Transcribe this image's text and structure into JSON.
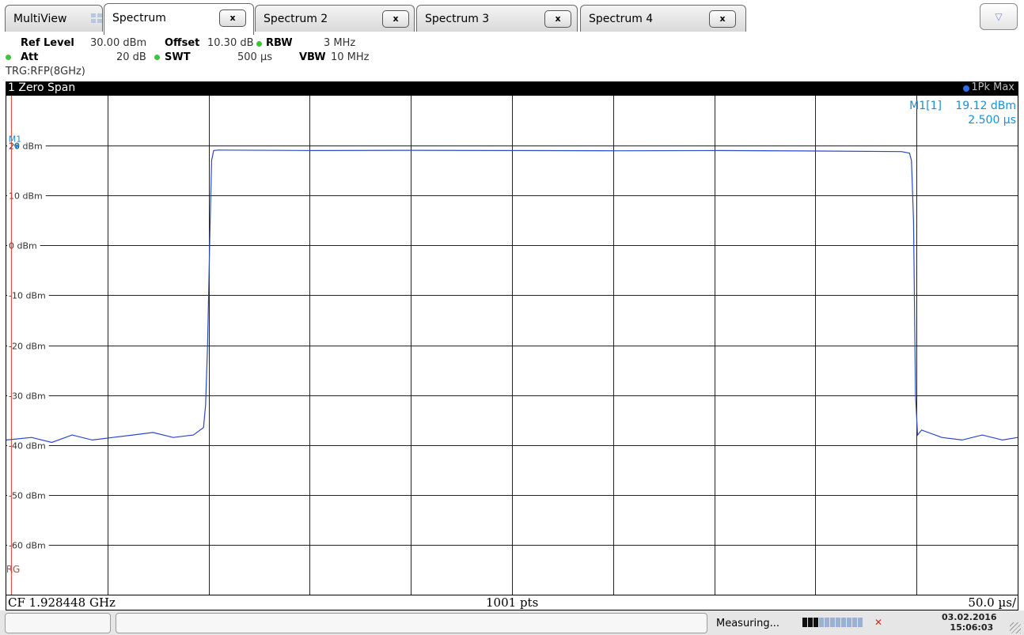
{
  "tabs": [
    {
      "label": "MultiView",
      "closable": false,
      "active": false
    },
    {
      "label": "Spectrum",
      "closable": true,
      "active": true
    },
    {
      "label": "Spectrum 2",
      "closable": true,
      "active": false
    },
    {
      "label": "Spectrum 3",
      "closable": true,
      "active": false
    },
    {
      "label": "Spectrum 4",
      "closable": true,
      "active": false
    }
  ],
  "tab_close_label": "x",
  "menu_icon": "triangle-down-icon",
  "menu_symbol": "▽",
  "settings": {
    "ref_level_label": "Ref Level",
    "ref_level_value": "30.00 dBm",
    "offset_label": "Offset",
    "offset_value": "10.30 dB",
    "rbw_label": "RBW",
    "rbw_value": "3 MHz",
    "att_label": "Att",
    "att_value": "20 dB",
    "swt_label": "SWT",
    "swt_value": "500 µs",
    "vbw_label": "VBW",
    "vbw_value": "10 MHz",
    "trigger": "TRG:RFP(8GHz)",
    "coupled_color": "#3ec33e"
  },
  "window": {
    "title": "1 Zero Span",
    "trace": "1Pk Max",
    "trace_color": "#2a6fe8"
  },
  "marker": {
    "label": "M1[1]",
    "level": "19.12 dBm",
    "time": "2.500 µs",
    "name": "M1",
    "color": "#1e8fd6"
  },
  "trigger_marker": {
    "label": "TRG",
    "color": "#e23b2e"
  },
  "footer": {
    "center_freq": "CF 1.928448 GHz",
    "points": "1001 pts",
    "scale": "50.0 µs/"
  },
  "status": {
    "state": "Measuring...",
    "date": "03.02.2016",
    "time": "15:06:03"
  },
  "chart_data": {
    "type": "line",
    "x_unit": "µs",
    "xlim": [
      -2.5,
      497.5
    ],
    "ylabel": "dBm",
    "ylim": [
      -70,
      30
    ],
    "yticks": [
      20,
      10,
      0,
      -10,
      -20,
      -30,
      -40,
      -50,
      -60
    ],
    "ytick_labels": [
      "20 dBm",
      "10 dBm",
      "0 dBm",
      "-10 dBm",
      "-20 dBm",
      "-30 dBm",
      "-40 dBm",
      "-50 dBm",
      "-60 dBm"
    ],
    "grid": true,
    "x_divisions": 10,
    "series": [
      {
        "name": "1Pk Max",
        "color": "#2a47c9",
        "x": [
          -2.5,
          10,
          20,
          30,
          40,
          50,
          60,
          70,
          80,
          90,
          95,
          96,
          97,
          98,
          99,
          100,
          102.5,
          105,
          150,
          200,
          250,
          300,
          350,
          400,
          440,
          444,
          445,
          446,
          447,
          448,
          450,
          460,
          470,
          480,
          490,
          497.5
        ],
        "y": [
          -39,
          -38.5,
          -39.5,
          -38,
          -39,
          -38.5,
          -38,
          -37.5,
          -38.5,
          -38,
          -36.5,
          -32,
          -20,
          0,
          17,
          19,
          19.12,
          19.1,
          19.0,
          19.05,
          19.0,
          18.95,
          19.0,
          18.9,
          18.8,
          18.5,
          17,
          5,
          -30,
          -38,
          -37,
          -38.5,
          -39,
          -38,
          -39,
          -38.5
        ]
      }
    ]
  }
}
